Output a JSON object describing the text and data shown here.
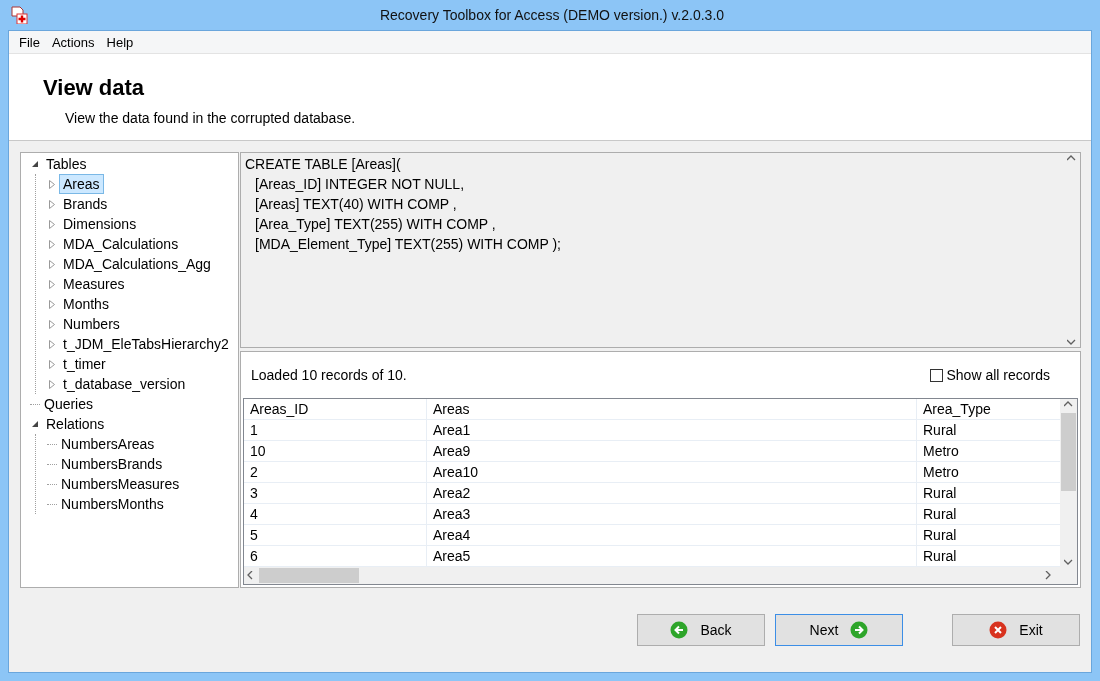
{
  "window": {
    "title": "Recovery Toolbox for Access (DEMO version.) v.2.0.3.0"
  },
  "menu": [
    "File",
    "Actions",
    "Help"
  ],
  "header": {
    "title": "View data",
    "subtitle": "View the data found in the corrupted database."
  },
  "tree": [
    {
      "label": "Tables",
      "expanded": true,
      "selected": false,
      "children": [
        {
          "label": "Areas",
          "expanded": false,
          "selected": true
        },
        {
          "label": "Brands",
          "expanded": false,
          "selected": false
        },
        {
          "label": "Dimensions",
          "expanded": false,
          "selected": false
        },
        {
          "label": "MDA_Calculations",
          "expanded": false,
          "selected": false
        },
        {
          "label": "MDA_Calculations_Agg",
          "expanded": false,
          "selected": false
        },
        {
          "label": "Measures",
          "expanded": false,
          "selected": false
        },
        {
          "label": "Months",
          "expanded": false,
          "selected": false
        },
        {
          "label": "Numbers",
          "expanded": false,
          "selected": false
        },
        {
          "label": "t_JDM_EleTabsHierarchy2",
          "expanded": false,
          "selected": false
        },
        {
          "label": "t_timer",
          "expanded": false,
          "selected": false
        },
        {
          "label": "t_database_version",
          "expanded": false,
          "selected": false
        }
      ]
    },
    {
      "label": "Queries",
      "selected": false
    },
    {
      "label": "Relations",
      "expanded": true,
      "selected": false,
      "children": [
        {
          "label": "NumbersAreas",
          "selected": false
        },
        {
          "label": "NumbersBrands",
          "selected": false
        },
        {
          "label": "NumbersMeasures",
          "selected": false
        },
        {
          "label": "NumbersMonths",
          "selected": false
        }
      ]
    }
  ],
  "sql": [
    "CREATE TABLE [Areas](",
    "[Areas_ID] INTEGER NOT NULL,",
    "[Areas] TEXT(40) WITH COMP ,",
    "[Area_Type] TEXT(255) WITH COMP ,",
    "[MDA_Element_Type] TEXT(255) WITH COMP );"
  ],
  "records": {
    "status": "Loaded 10 records of 10.",
    "show_all": {
      "label": "Show all records",
      "checked": false
    }
  },
  "table": {
    "columns": [
      "Areas_ID",
      "Areas",
      "Area_Type"
    ],
    "rows": [
      [
        "1",
        "Area1",
        "Rural"
      ],
      [
        "10",
        "Area9",
        "Metro"
      ],
      [
        "2",
        "Area10",
        "Metro"
      ],
      [
        "3",
        "Area2",
        "Rural"
      ],
      [
        "4",
        "Area3",
        "Rural"
      ],
      [
        "5",
        "Area4",
        "Rural"
      ],
      [
        "6",
        "Area5",
        "Rural"
      ]
    ]
  },
  "buttons": [
    {
      "label": "Back",
      "kind": "back",
      "default": false
    },
    {
      "label": "Next",
      "kind": "next",
      "default": true
    },
    {
      "label": "Exit",
      "kind": "exit",
      "default": false
    }
  ]
}
